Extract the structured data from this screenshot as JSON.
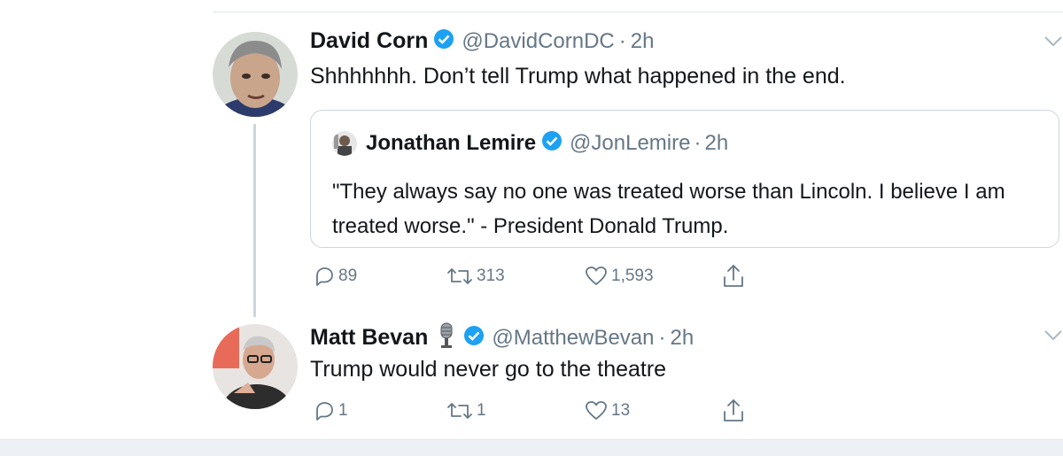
{
  "tweets": [
    {
      "author": "David Corn",
      "handle": "@DavidCornDC",
      "separator": "·",
      "time": "2h",
      "text": "Shhhhhhh.  Don’t tell Trump what happened in the end.",
      "quote": {
        "author": "Jonathan Lemire",
        "handle": "@JonLemire",
        "separator": "·",
        "time": "2h",
        "text": "\"They always say no one was treated worse than Lincoln. I believe I am treated worse.\" - President Donald Trump."
      },
      "actions": {
        "replies": "89",
        "retweets": "313",
        "likes": "1,593"
      }
    },
    {
      "author": "Matt Bevan",
      "emoji": "microphone-icon",
      "handle": "@MatthewBevan",
      "separator": "·",
      "time": "2h",
      "text": "Trump would never go to the theatre",
      "actions": {
        "replies": "1",
        "retweets": "1",
        "likes": "13"
      }
    }
  ],
  "colors": {
    "verified": "#1da1f2",
    "muted": "#657786",
    "border": "#ccd6dd"
  }
}
